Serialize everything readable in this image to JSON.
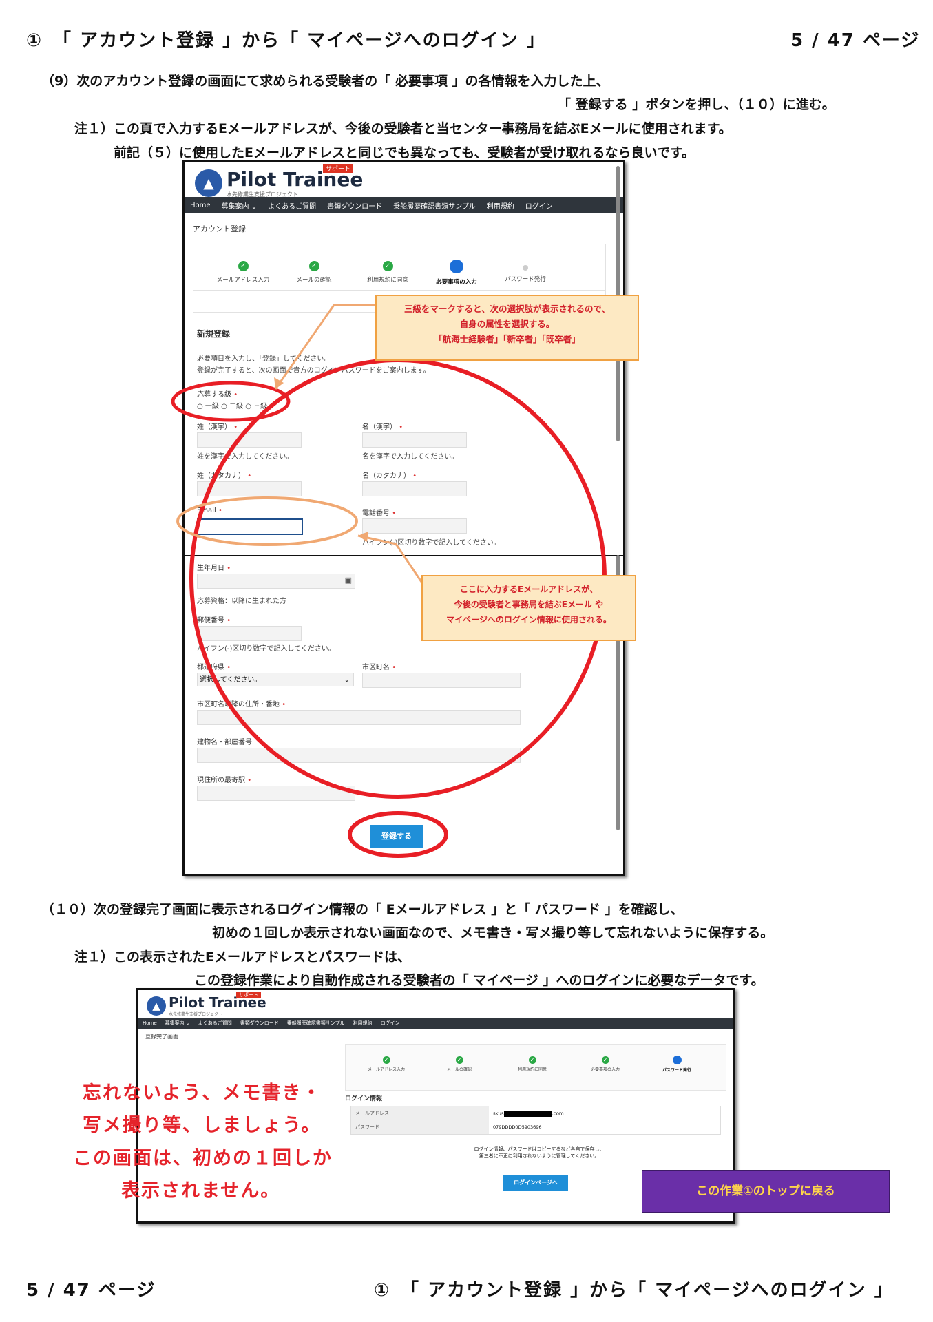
{
  "header": {
    "left": "①　「 アカウント登録 」から「 マイページへのログイン 」",
    "right": "5 / 47 ページ"
  },
  "section9": {
    "line1": "（9）次のアカウント登録の画面にて求められる受験者の「 必要事項 」の各情報を入力した上、",
    "line2": "「 登録する 」ボタンを押し、（１０）に進む。",
    "note1": "注１）この頁で入力するEメールアドレスが、今後の受験者と当センター事務局を結ぶEメールに使用されます。",
    "note2": "前記（５）に使用したEメールアドレスと同じでも異なっても、受験者が受け取れるなら良いです。"
  },
  "site": {
    "logo_name": "Pilot Trainee",
    "logo_tag": "サポート",
    "logo_sub": "水先修業生支援プロジェクト",
    "nav": [
      "Home",
      "募集案内 ⌄",
      "よくあるご質問",
      "書類ダウンロード",
      "乗船履歴確認書類サンプル",
      "利用規約",
      "ログイン"
    ]
  },
  "form": {
    "page_title": "アカウント登録",
    "steps": [
      "メールアドレス入力",
      "メールの確認",
      "利用規約に同意",
      "必要事項の入力",
      "パスワード発行"
    ],
    "section_title": "新規登録",
    "intro1": "必要項目を入力し、「登録」してください。",
    "intro2": "登録が完了すると、次の画面で貴方のログインパスワードをご案内します。",
    "grade_label": "応募する級",
    "grade_options": [
      "一級",
      "二級",
      "三級"
    ],
    "last_kanji": "姓（漢字）",
    "last_kanji_help": "姓を漢字で入力してください。",
    "first_kanji": "名（漢字）",
    "first_kanji_help": "名を漢字で入力してください。",
    "last_kana": "姓（カタカナ）",
    "first_kana": "名（カタカナ）",
    "email": "Email",
    "phone": "電話番号",
    "phone_help": "ハイフン(-)区切り数字で記入してください。",
    "birthday": "生年月日",
    "birthday_help": "応募資格：以降に生まれた方",
    "postal": "郵便番号",
    "postal_help": "ハイフン(-)区切り数字で記入してください。",
    "prefecture": "都道府県",
    "prefecture_value": "選択してください。",
    "city": "市区町名",
    "address": "市区町名以降の住所・番地",
    "building": "建物名・部屋番号",
    "station": "現住所の最寄駅",
    "submit": "登録する"
  },
  "callouts": {
    "grade": [
      "三級をマークすると、次の選択肢が表示されるので、",
      "自身の属性を選択する。",
      "「航海士経験者」「新卒者」「既卒者」"
    ],
    "email": [
      "ここに入力するEメールアドレスが、",
      "今後の受験者と事務局を結ぶEメール や",
      "マイページへのログイン情報に使用される。"
    ]
  },
  "section10": {
    "line1": "（１０）次の登録完了画面に表示されるログイン情報の「 Eメールアドレス 」と「 パスワード 」を確認し、",
    "line2": "初めの１回しか表示されない画面なので、メモ書き・写メ撮り等して忘れないように保存する。",
    "note1": "注１）この表示されたEメールアドレスとパスワードは、",
    "note2": "この登録作業により自動作成される受験者の「 マイページ 」へのログインに必要なデータです。"
  },
  "complete": {
    "page_title": "登録完了画面",
    "login_info": "ログイン情報",
    "email_label": "メールアドレス",
    "email_value_prefix": "skus",
    "email_value_suffix": ".com",
    "password_label": "パスワード",
    "password_value": "079DDDD0D5903696",
    "note1": "ログイン情報、パスワードはコピーするなど各自で保存し、",
    "note2": "第三者に不正に利用されないように管理してください。",
    "login_button": "ログインページへ"
  },
  "memo": [
    "忘れないよう、メモ書き・",
    "写メ撮り等、しましょう。",
    "この画面は、初めの１回しか",
    "表示されません。"
  ],
  "back_button": "この作業①のトップに戻る",
  "footer": {
    "left": "5 / 47 ページ",
    "right": "①　「 アカウント登録 」から「 マイページへのログイン 」"
  }
}
